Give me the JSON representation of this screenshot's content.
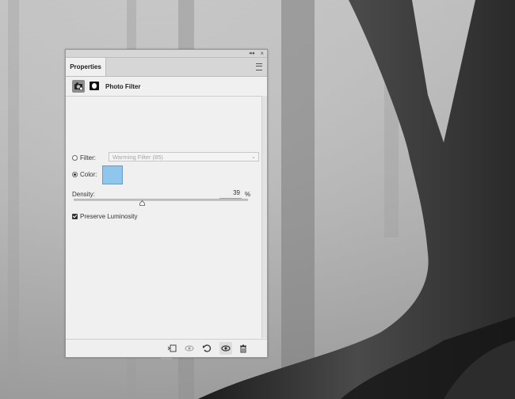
{
  "panel": {
    "tab_label": "Properties",
    "title": "Photo Filter",
    "filter": {
      "label": "Filter:",
      "value": "Warming Filter (85)",
      "selected": false
    },
    "color": {
      "label": "Color:",
      "swatch_color": "#8ec6ee",
      "selected": true
    },
    "density": {
      "label": "Density:",
      "value": "39",
      "unit": "%",
      "fraction": 0.39
    },
    "preserve_luminosity": {
      "label": "Preserve Luminosity",
      "checked": true
    },
    "footer_icons": [
      "clip-to-layer-icon",
      "view-previous-state-icon",
      "reset-icon",
      "visibility-eye-icon",
      "trash-icon"
    ]
  },
  "colors": {
    "panel_bg": "#f0f0f0",
    "tab_bar": "#d6d6d6"
  }
}
